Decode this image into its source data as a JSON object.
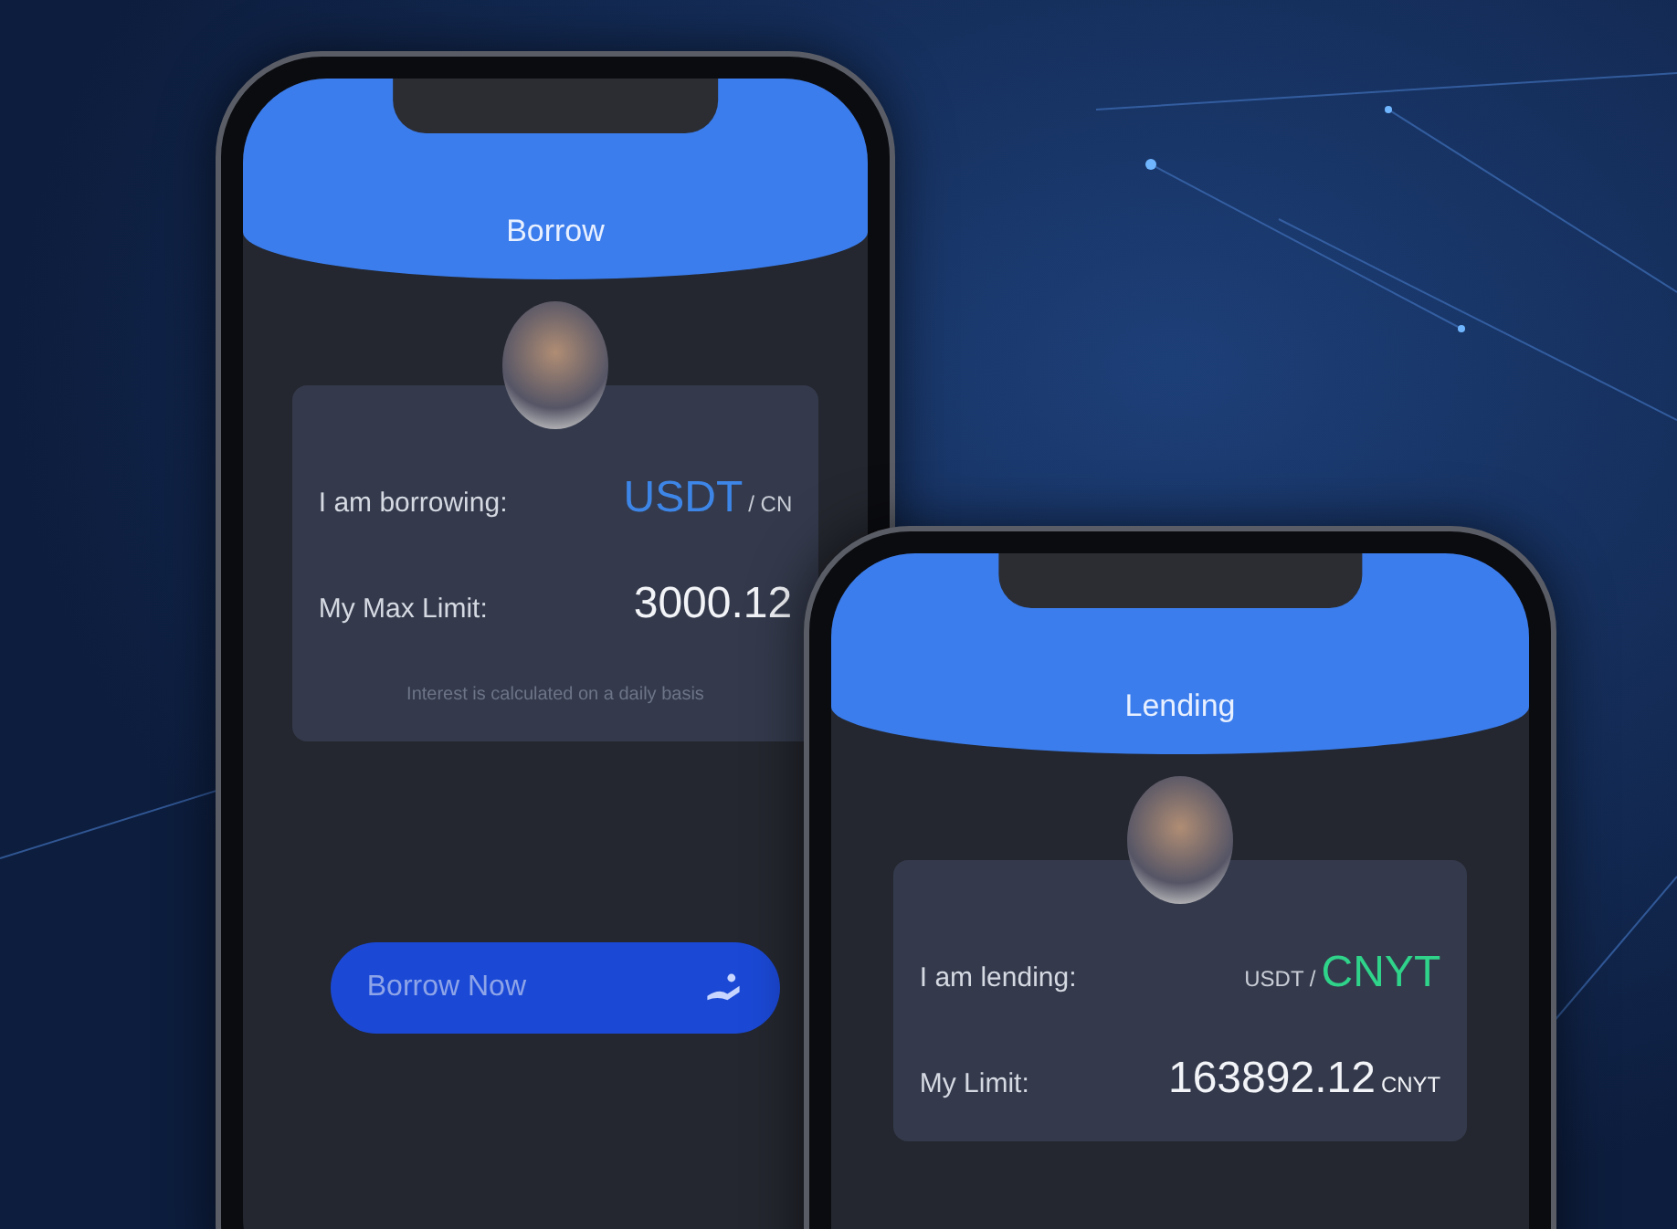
{
  "phones": [
    {
      "title": "Borrow",
      "rows": [
        {
          "label": "I am borrowing:",
          "parts": [
            {
              "text": "USDT",
              "kind": "main",
              "color": "#3d86e8"
            },
            {
              "text": "/ CN",
              "kind": "unit",
              "color": "#c9cdd6"
            }
          ]
        },
        {
          "label": "My Max Limit:",
          "parts": [
            {
              "text": "3000.12",
              "kind": "main",
              "color": "#f2f4f8"
            }
          ]
        }
      ],
      "note": "Interest is calculated on a daily basis",
      "button": "Borrow Now"
    },
    {
      "title": "Lending",
      "rows": [
        {
          "label": "I am lending:",
          "parts": [
            {
              "text": "USDT /",
              "kind": "unit",
              "color": "#c9cdd6"
            },
            {
              "text": "CNYT",
              "kind": "main",
              "color": "#2fd38a"
            }
          ]
        },
        {
          "label": "My Limit:",
          "parts": [
            {
              "text": "163892.12",
              "kind": "main",
              "color": "#f2f4f8"
            },
            {
              "text": "CNYT",
              "kind": "unit",
              "color": "#f2f4f8"
            }
          ]
        }
      ]
    }
  ]
}
